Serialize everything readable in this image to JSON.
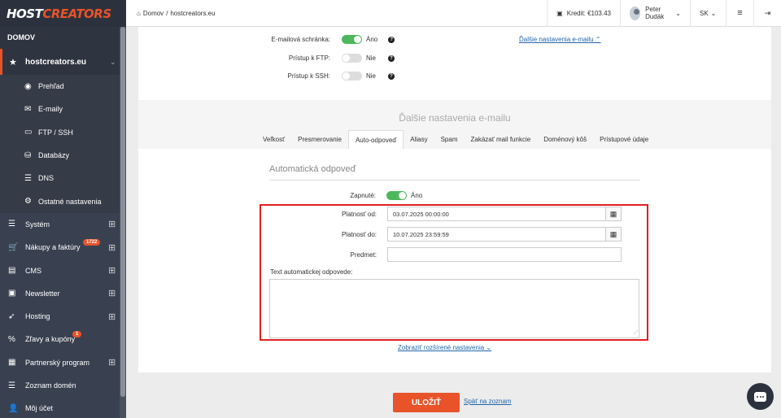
{
  "logo": {
    "part1": "HOST",
    "part2": "CREATORS"
  },
  "sidebar": {
    "section": "DOMOV",
    "site": "hostcreators.eu",
    "subitems": [
      {
        "label": "Prehľad",
        "icon": "globe-icon"
      },
      {
        "label": "E-maily",
        "icon": "envelope-icon"
      },
      {
        "label": "FTP / SSH",
        "icon": "folder-icon"
      },
      {
        "label": "Databázy",
        "icon": "database-icon"
      },
      {
        "label": "DNS",
        "icon": "server-icon"
      },
      {
        "label": "Ostatné nastavenia",
        "icon": "gear-icon"
      }
    ],
    "items": [
      {
        "label": "Systém",
        "icon": "server-icon"
      },
      {
        "label": "Nákupy a faktúry",
        "badge": "1722",
        "icon": "cart-icon"
      },
      {
        "label": "CMS",
        "icon": "document-icon"
      },
      {
        "label": "Newsletter",
        "icon": "newsletter-icon"
      },
      {
        "label": "Hosting",
        "icon": "rocket-icon"
      },
      {
        "label": "Zľavy a kupóny",
        "badge": "1",
        "icon": "percent-icon"
      },
      {
        "label": "Partnerský program",
        "icon": "id-card-icon"
      },
      {
        "label": "Zoznam domén",
        "icon": "list-icon"
      },
      {
        "label": "Môj účet",
        "icon": "user-icon"
      }
    ]
  },
  "topbar": {
    "home": "Domov",
    "separator": "/",
    "current": "hostcreators.eu",
    "credit": "Kredit: €103.43",
    "user": "Peter Dudák",
    "lang": "SK"
  },
  "access": {
    "mailbox_label": "E-mailová schránka:",
    "mailbox_value": "Áno",
    "ftp_label": "Prístup k FTP:",
    "ftp_value": "Nie",
    "ssh_label": "Prístup k SSH:",
    "ssh_value": "Nie",
    "more_link": "Ďalšie nastavenia e-mailu ⌃"
  },
  "settings": {
    "title": "Ďalšie nastavenia e-mailu",
    "tabs": [
      "Veľkosť",
      "Presmerovanie",
      "Auto-odpoveď",
      "Aliasy",
      "Spam",
      "Zakázať mail funkcie",
      "Doménový kôš",
      "Prístupové údaje"
    ],
    "active_tab": "Auto-odpoveď"
  },
  "autoreply": {
    "section_title": "Automatická odpoveď",
    "enabled_label": "Zapnuté:",
    "enabled_value": "Áno",
    "valid_from_label": "Platnosť od:",
    "valid_from_value": "03.07.2025 00:00:00",
    "valid_to_label": "Platnosť do:",
    "valid_to_value": "10.07.2025 23:59:59",
    "subject_label": "Predmet:",
    "subject_value": "",
    "text_label": "Text automatickej odpovede:",
    "text_value": "",
    "advanced_link": "Zobraziť rozšírené nastavenia ⌄"
  },
  "actions": {
    "save": "ULOŽIŤ",
    "back": "Späť na zoznam"
  },
  "colors": {
    "accent": "#e8532a",
    "toggle_on": "#4cb85c",
    "highlight": "#e02020"
  }
}
